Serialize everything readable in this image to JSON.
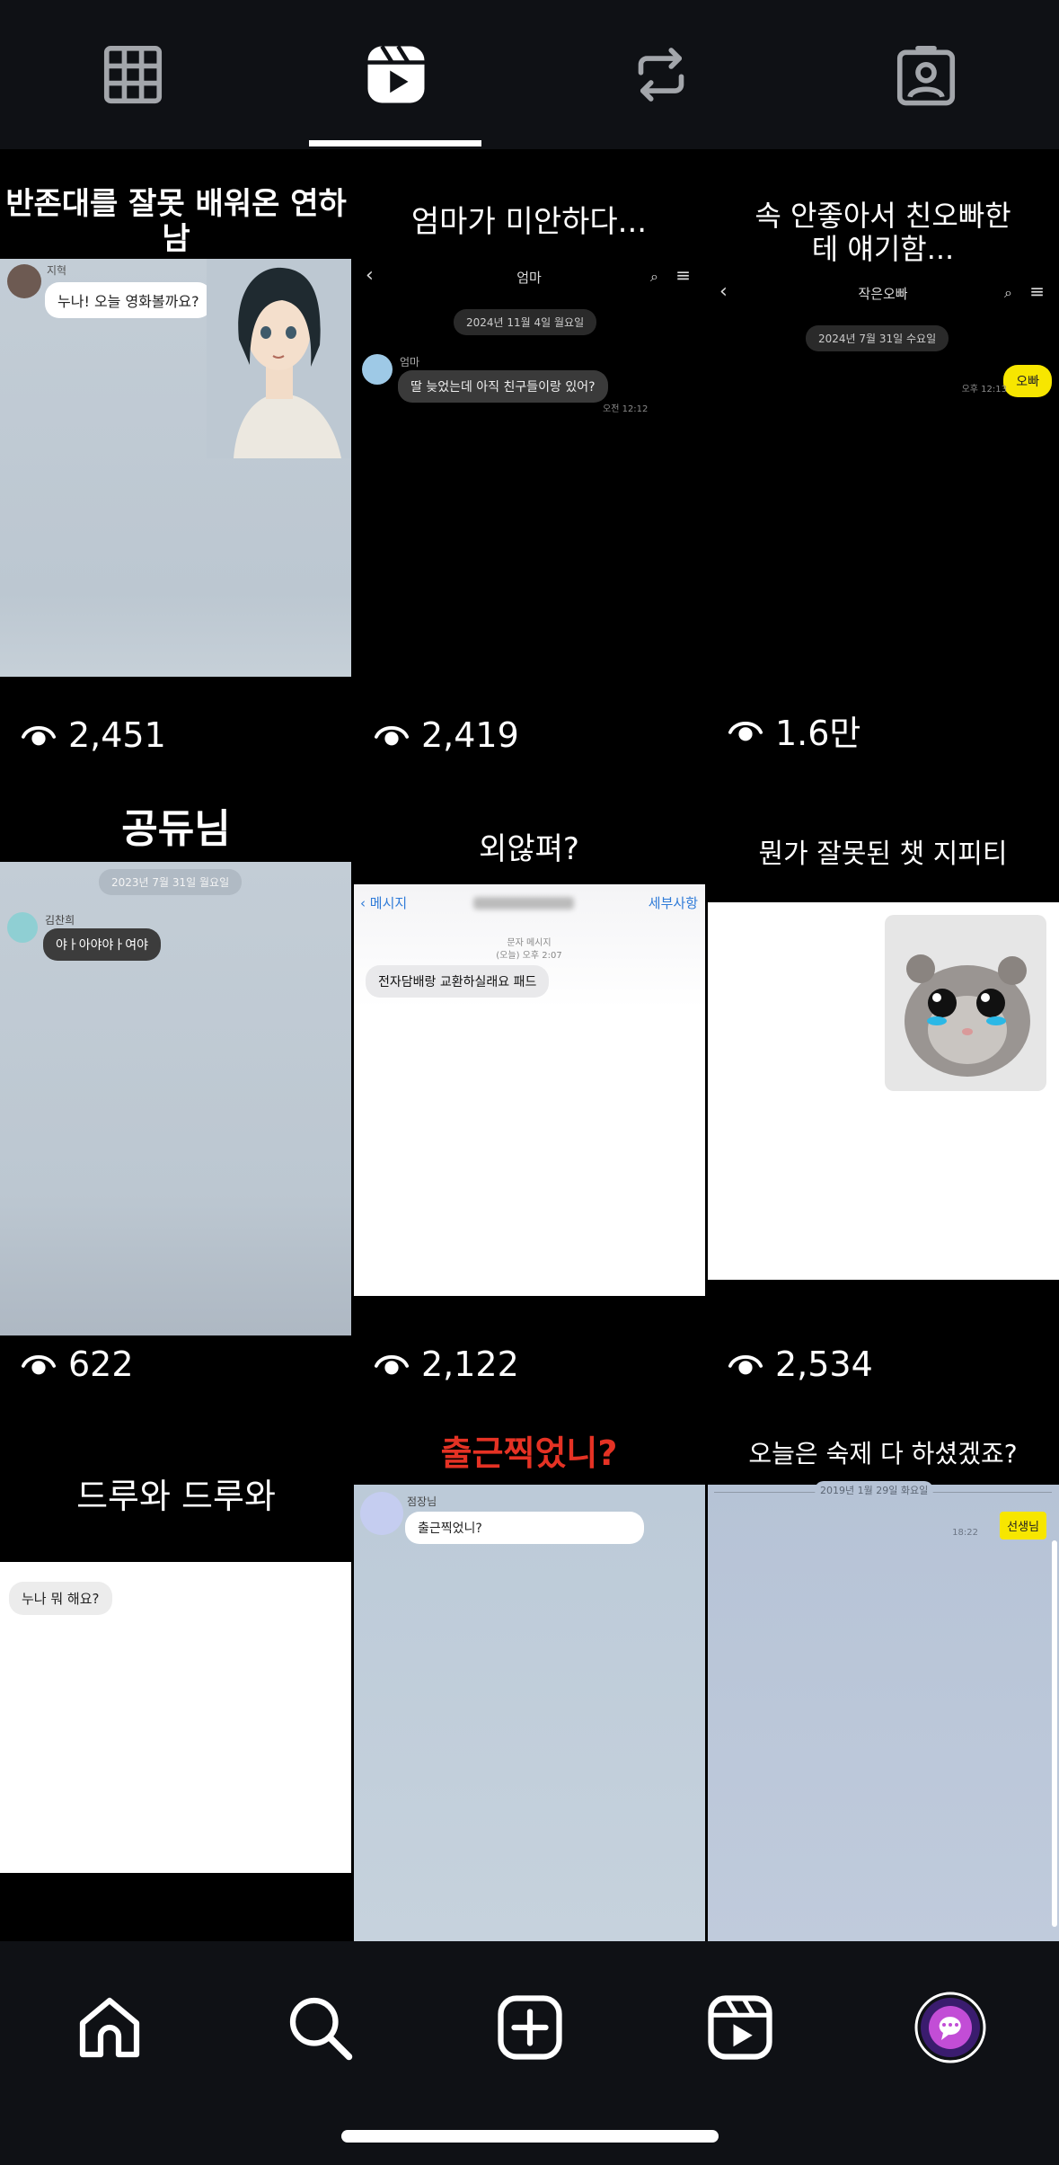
{
  "tabs": [
    {
      "icon": "grid-icon"
    },
    {
      "icon": "reels-icon",
      "active": true
    },
    {
      "icon": "repost-icon"
    },
    {
      "icon": "tagged-icon"
    }
  ],
  "tiles": [
    {
      "title": "반존대를 잘못 배워온 연하남",
      "views": "2,451",
      "chat": {
        "sender": "지혁",
        "bubble": "누나! 오늘 영화볼까요?"
      }
    },
    {
      "title": "엄마가 미안하다...",
      "views": "2,419",
      "chat": {
        "header": "엄마",
        "date": "2024년 11월 4일 월요일",
        "sender": "엄마",
        "bubble": "딸 늦었는데 아직 친구들이랑 있어?",
        "time": "오전 12:12"
      }
    },
    {
      "title": "속 안좋아서 친오빠한테 얘기함...",
      "views": "1.6만",
      "chat": {
        "header": "작은오빠",
        "date": "2024년 7월 31일 수요일",
        "bubble": "오빠",
        "time": "오후 12:13"
      }
    },
    {
      "title": "공듀님",
      "views": "622",
      "chat": {
        "date": "2023년 7월 31일 월요일",
        "sender": "김찬희",
        "bubble": "야ㅏ아야야ㅏ여야"
      }
    },
    {
      "title": "외않펴?",
      "views": "2,122",
      "chat": {
        "back": "메시지",
        "detail": "세부사항",
        "kind": "문자 메시지",
        "when": "(오늘) 오후 2:07",
        "bubble": "전자담배랑 교환하실래요 패드"
      }
    },
    {
      "title": "뭔가 잘못된 챗 지피티",
      "views": "2,534"
    },
    {
      "title": "드루와 드루와",
      "chat": {
        "bubble": "누나 뭐 해요?"
      }
    },
    {
      "title": "출근찍었니?",
      "chat": {
        "sender": "점장님",
        "bubble": "출근찍었니?"
      }
    },
    {
      "title": "오늘은 숙제 다 하셨겠죠?",
      "chat": {
        "date": "2019년 1월 29일 화요일",
        "bubble": "선생님",
        "time": "18:22"
      }
    }
  ],
  "nav": [
    {
      "icon": "home-icon"
    },
    {
      "icon": "search-icon"
    },
    {
      "icon": "create-icon"
    },
    {
      "icon": "reels-icon"
    },
    {
      "icon": "profile-avatar"
    }
  ]
}
